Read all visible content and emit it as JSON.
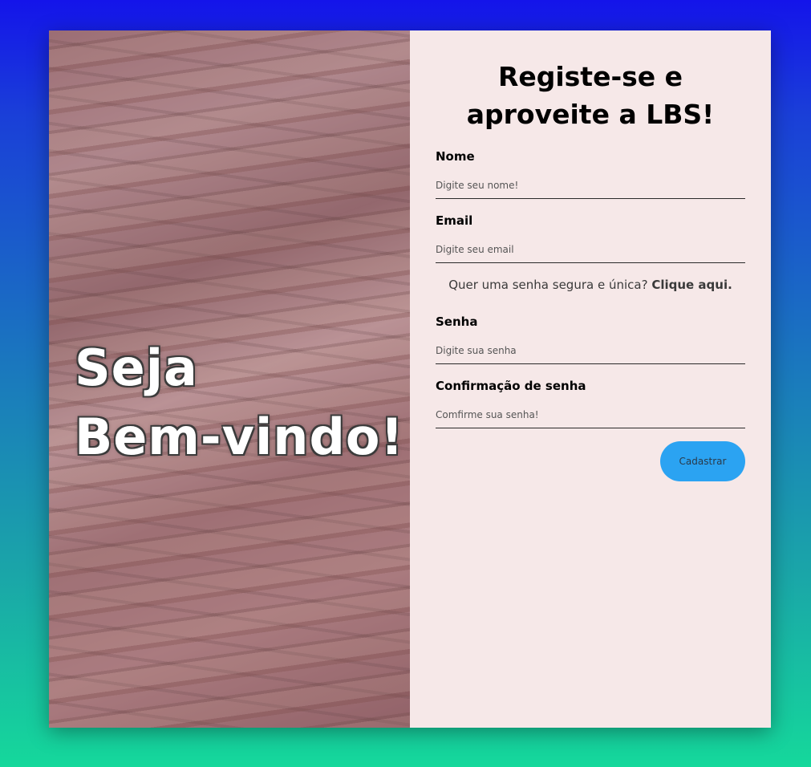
{
  "hero": {
    "line1": "Seja",
    "line2": "Bem-vindo!"
  },
  "form": {
    "title": "Registe-se e aproveite a LBS!",
    "fields": {
      "name": {
        "label": "Nome",
        "placeholder": "Digite seu nome!"
      },
      "email": {
        "label": "Email",
        "placeholder": "Digite seu email"
      },
      "password": {
        "label": "Senha",
        "placeholder": "Digite sua senha"
      },
      "confirm": {
        "label": "Confirmação de senha",
        "placeholder": "Comfirme sua senha!"
      }
    },
    "password_hint": {
      "text": "Quer uma senha segura e única? ",
      "link": "Clique aqui."
    },
    "submit_label": "Cadastrar"
  },
  "colors": {
    "background_top": "#1414ea",
    "background_bottom": "#15d89b",
    "form_panel": "#f6e8e8",
    "button": "#2ba3f2"
  }
}
